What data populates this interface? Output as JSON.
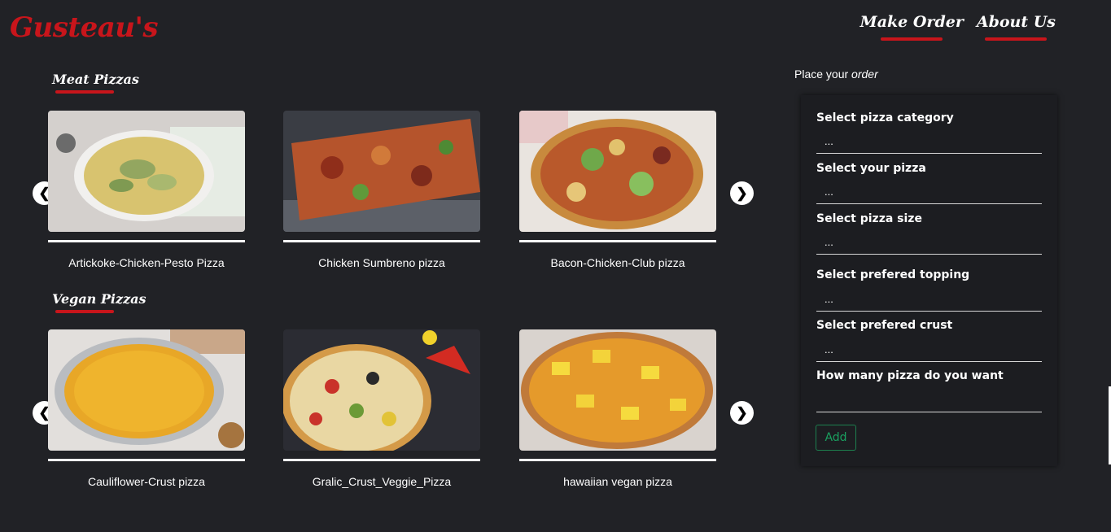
{
  "brand": {
    "logo": "Gusteau's"
  },
  "nav": {
    "links": [
      "Make Order",
      "About Us"
    ]
  },
  "sections": [
    {
      "title": "Meat Pizzas",
      "items": [
        "Artickoke-Chicken-Pesto Pizza",
        "Chicken Sumbreno pizza",
        "Bacon-Chicken-Club pizza"
      ]
    },
    {
      "title": "Vegan Pizzas",
      "items": [
        "Cauliflower-Crust pizza",
        "Gralic_Crust_Veggie_Pizza",
        "hawaiian vegan pizza"
      ]
    }
  ],
  "order": {
    "heading_prefix": "Place your ",
    "heading_emph": "order",
    "fields": [
      {
        "label": "Select pizza category",
        "value": "..."
      },
      {
        "label": "Select your pizza",
        "value": "..."
      },
      {
        "label": "Select pizza size",
        "value": "..."
      },
      {
        "label": "Select prefered topping",
        "value": "..."
      },
      {
        "label": "Select prefered crust",
        "value": "..."
      },
      {
        "label": "How many pizza do you want",
        "value": ""
      }
    ],
    "add_label": "Add"
  },
  "icons": {
    "prev": "chevron-left-icon",
    "next": "chevron-right-icon"
  },
  "colors": {
    "background": "#212226",
    "accent": "#c8151b",
    "add_button": "#1aa160"
  }
}
